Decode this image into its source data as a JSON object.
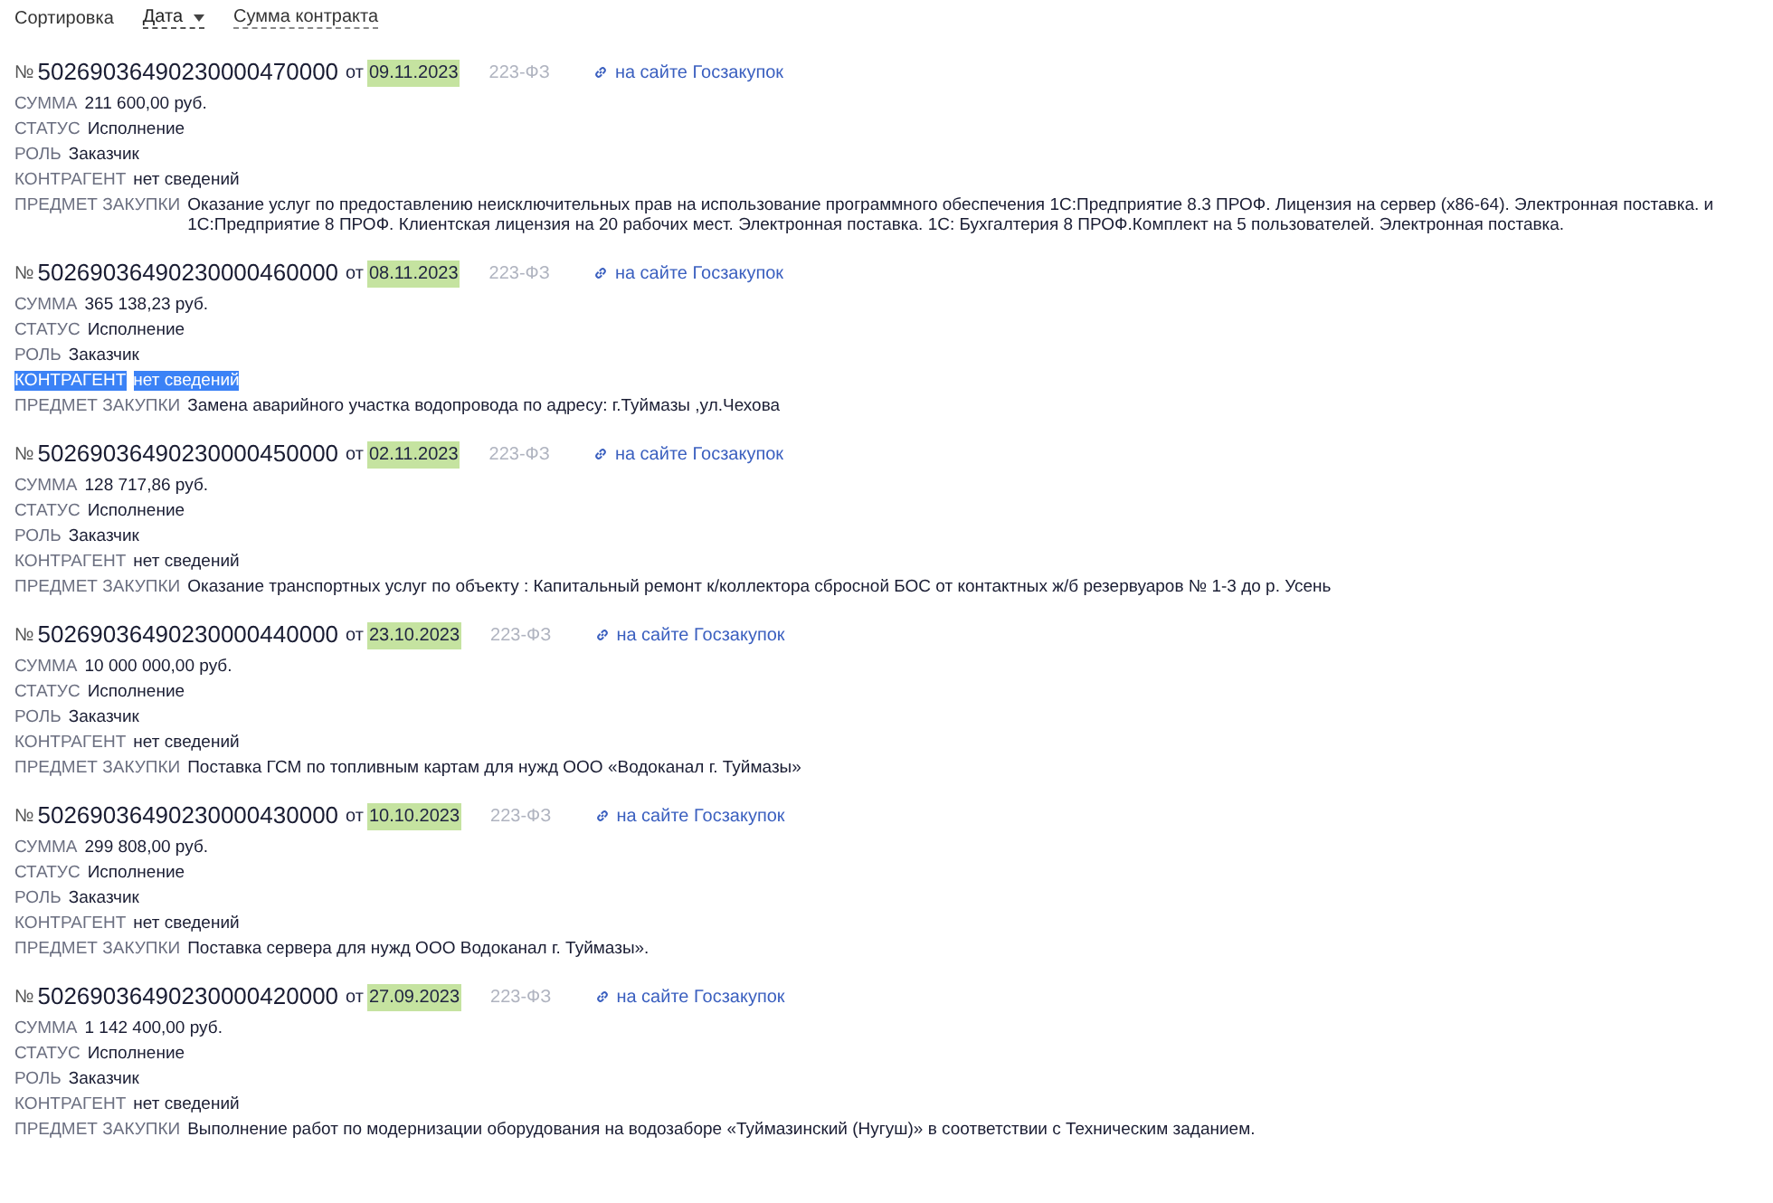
{
  "sort": {
    "label": "Сортировка",
    "options": [
      {
        "label": "Дата",
        "selected": true
      },
      {
        "label": "Сумма контракта",
        "selected": false
      }
    ]
  },
  "records": [
    {
      "number_sign": "№",
      "number": "50269036490230000470000",
      "date_prefix": "от",
      "date": "09.11.2023",
      "law": "223-ФЗ",
      "link": "на сайте Госзакупок",
      "fields": [
        {
          "label": "СУММА",
          "value": "211 600,00 руб.",
          "highlighted": false
        },
        {
          "label": "СТАТУС",
          "value": "Исполнение",
          "highlighted": false
        },
        {
          "label": "РОЛЬ",
          "value": "Заказчик",
          "highlighted": false
        },
        {
          "label": "КОНТРАГЕНТ",
          "value": "нет сведений",
          "highlighted": false
        },
        {
          "label": "ПРЕДМЕТ ЗАКУПКИ",
          "value": "Оказание услуг по предоставлению неисключительных прав на использование программного обеспечения 1С:Предприятие 8.3 ПРОФ. Лицензия на сервер (x86-64). Электронная поставка. и 1С:Предприятие 8 ПРОФ. Клиентская лицензия на 20 рабочих мест. Электронная поставка. 1С: Бухгалтерия 8 ПРОФ.Комплект на 5 пользователей. Электронная поставка.",
          "highlighted": false
        }
      ]
    },
    {
      "number_sign": "№",
      "number": "50269036490230000460000",
      "date_prefix": "от",
      "date": "08.11.2023",
      "law": "223-ФЗ",
      "link": "на сайте Госзакупок",
      "fields": [
        {
          "label": "СУММА",
          "value": "365 138,23 руб.",
          "highlighted": false
        },
        {
          "label": "СТАТУС",
          "value": "Исполнение",
          "highlighted": false
        },
        {
          "label": "РОЛЬ",
          "value": "Заказчик",
          "highlighted": false
        },
        {
          "label": "КОНТРАГЕНТ",
          "value": "нет сведений",
          "highlighted": true
        },
        {
          "label": "ПРЕДМЕТ ЗАКУПКИ",
          "value": "Замена аварийного участка водопровода по адресу: г.Туймазы ,ул.Чехова",
          "highlighted": false
        }
      ]
    },
    {
      "number_sign": "№",
      "number": "50269036490230000450000",
      "date_prefix": "от",
      "date": "02.11.2023",
      "law": "223-ФЗ",
      "link": "на сайте Госзакупок",
      "fields": [
        {
          "label": "СУММА",
          "value": "128 717,86 руб.",
          "highlighted": false
        },
        {
          "label": "СТАТУС",
          "value": "Исполнение",
          "highlighted": false
        },
        {
          "label": "РОЛЬ",
          "value": "Заказчик",
          "highlighted": false
        },
        {
          "label": "КОНТРАГЕНТ",
          "value": "нет сведений",
          "highlighted": false
        },
        {
          "label": "ПРЕДМЕТ ЗАКУПКИ",
          "value": "Оказание транспортных услуг по объекту : Капитальный ремонт к/коллектора сбросной БОС от контактных ж/б резервуаров № 1-3 до р. Усень",
          "highlighted": false
        }
      ]
    },
    {
      "number_sign": "№",
      "number": "50269036490230000440000",
      "date_prefix": "от",
      "date": "23.10.2023",
      "law": "223-ФЗ",
      "link": "на сайте Госзакупок",
      "fields": [
        {
          "label": "СУММА",
          "value": "10 000 000,00 руб.",
          "highlighted": false
        },
        {
          "label": "СТАТУС",
          "value": "Исполнение",
          "highlighted": false
        },
        {
          "label": "РОЛЬ",
          "value": "Заказчик",
          "highlighted": false
        },
        {
          "label": "КОНТРАГЕНТ",
          "value": "нет сведений",
          "highlighted": false
        },
        {
          "label": "ПРЕДМЕТ ЗАКУПКИ",
          "value": "Поставка ГСМ по топливным картам для нужд ООО «Водоканал г. Туймазы»",
          "highlighted": false
        }
      ]
    },
    {
      "number_sign": "№",
      "number": "50269036490230000430000",
      "date_prefix": "от",
      "date": "10.10.2023",
      "law": "223-ФЗ",
      "link": "на сайте Госзакупок",
      "fields": [
        {
          "label": "СУММА",
          "value": "299 808,00 руб.",
          "highlighted": false
        },
        {
          "label": "СТАТУС",
          "value": "Исполнение",
          "highlighted": false
        },
        {
          "label": "РОЛЬ",
          "value": "Заказчик",
          "highlighted": false
        },
        {
          "label": "КОНТРАГЕНТ",
          "value": "нет сведений",
          "highlighted": false
        },
        {
          "label": "ПРЕДМЕТ ЗАКУПКИ",
          "value": "Поставка сервера для нужд ООО Водоканал г. Туймазы».",
          "highlighted": false
        }
      ]
    },
    {
      "number_sign": "№",
      "number": "50269036490230000420000",
      "date_prefix": "от",
      "date": "27.09.2023",
      "law": "223-ФЗ",
      "link": "на сайте Госзакупок",
      "fields": [
        {
          "label": "СУММА",
          "value": "1 142 400,00 руб.",
          "highlighted": false
        },
        {
          "label": "СТАТУС",
          "value": "Исполнение",
          "highlighted": false
        },
        {
          "label": "РОЛЬ",
          "value": "Заказчик",
          "highlighted": false
        },
        {
          "label": "КОНТРАГЕНТ",
          "value": "нет сведений",
          "highlighted": false
        },
        {
          "label": "ПРЕДМЕТ ЗАКУПКИ",
          "value": "Выполнение работ по модернизации оборудования на водозаборе «Туймазинский (Нугуш)» в соответствии с Техническим заданием.",
          "highlighted": false
        }
      ]
    }
  ]
}
